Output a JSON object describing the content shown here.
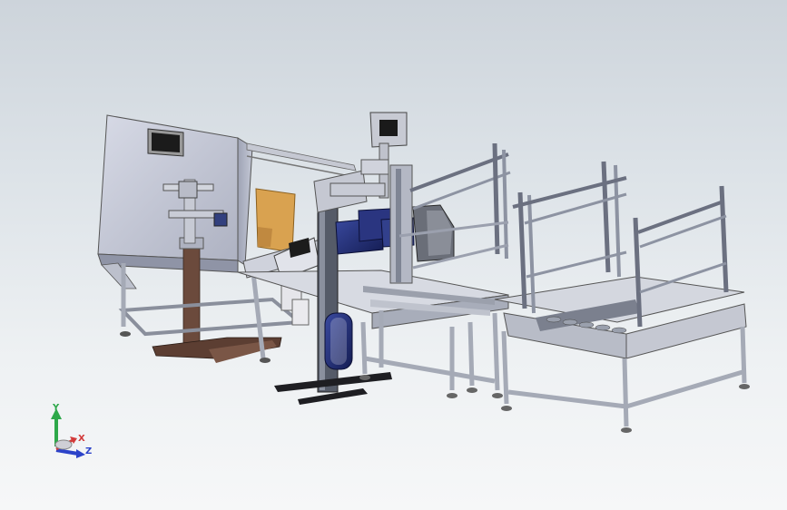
{
  "viewport": {
    "background_top": "#cdd4db",
    "background_bottom": "#f6f7f8"
  },
  "model": {
    "frame_color": "#b8bfc8",
    "panel_color": "#c9ccdb",
    "accent_blue": "#1f2a6b",
    "cardboard_color": "#d9a250",
    "stand_color": "#6b4a3c"
  },
  "triad": {
    "y_label": "Y",
    "x_label": "X",
    "z_label": "Z",
    "y_color": "#2ea84a",
    "x_color": "#d23a3a",
    "z_color": "#2c43c9"
  }
}
